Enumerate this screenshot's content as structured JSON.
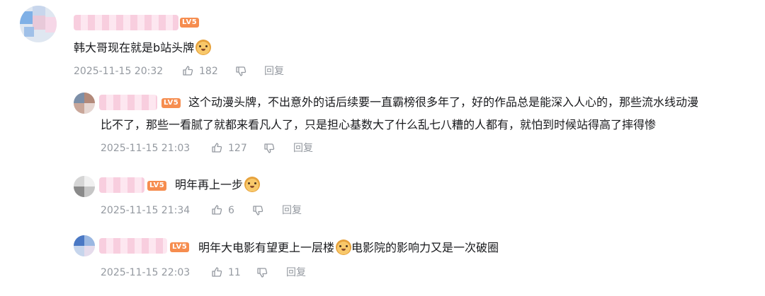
{
  "comments": [
    {
      "text": "韩大哥现在就是b站头牌",
      "level": "LV5",
      "time": "2025-11-15 20:32",
      "likes": "182",
      "reply_label": "回复",
      "emoji": "doge-emoji"
    }
  ],
  "replies": [
    {
      "text": "这个动漫头牌，不出意外的话后续要一直霸榜很多年了，好的作品总是能深入人心的，那些流水线动漫比不了，那些一看腻了就都来看凡人了，只是担心基数大了什么乱七八糟的人都有，就怕到时候站得高了摔得惨",
      "text_line1": "这个动漫头牌，不出意外的话后续要一直霸榜很多年了，好的作品总是能深入人心的，那些流水线动漫",
      "text_line2": "比不了，那些一看腻了就都来看凡人了，只是担心基数大了什么乱七八糟的人都有，就怕到时候站得高了摔得惨",
      "level": "LV5",
      "time": "2025-11-15 21:03",
      "likes": "127",
      "reply_label": "回复"
    },
    {
      "text": "明年再上一步",
      "level": "LV5",
      "time": "2025-11-15 21:34",
      "likes": "6",
      "reply_label": "回复",
      "emoji": "doge-emoji"
    },
    {
      "text_a": "明年大电影有望更上一层楼",
      "text_b": "电影院的影响力又是一次破圈",
      "level": "LV5",
      "time": "2025-11-15 22:03",
      "likes": "11",
      "reply_label": "回复",
      "emoji": "shocked-doge-emoji"
    }
  ],
  "colors": {
    "level_badge": "#f68d4f",
    "meta_text": "#9499a0",
    "body_text": "#18191c"
  }
}
